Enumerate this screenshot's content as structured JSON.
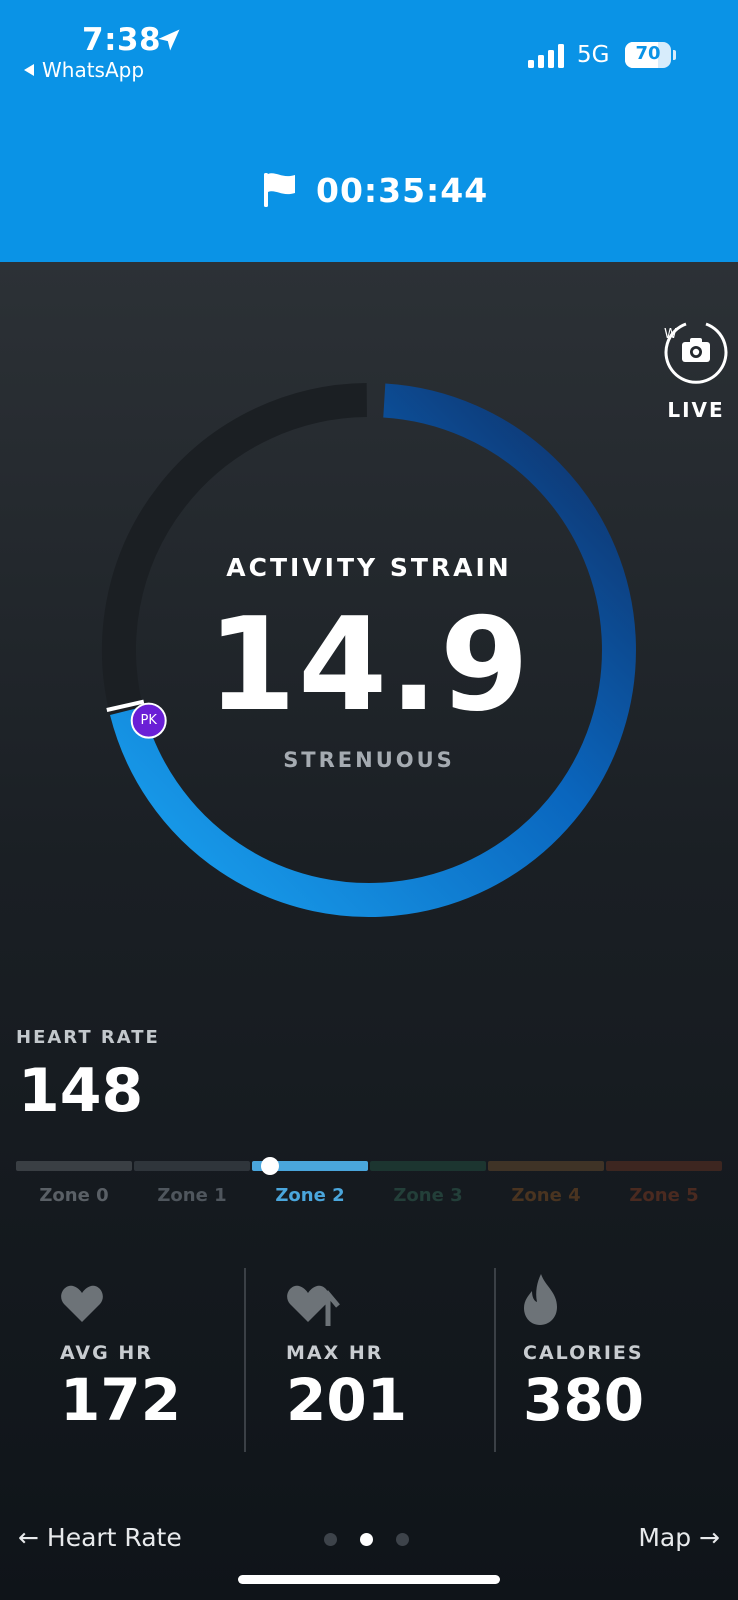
{
  "status_bar": {
    "time": "7:38",
    "back_app": "WhatsApp",
    "network": "5G",
    "battery": "70"
  },
  "header": {
    "timer": "00:35:44",
    "flag_icon": "flag-icon"
  },
  "live": {
    "label": "LIVE",
    "icon": "camera-icon"
  },
  "strain": {
    "title": "ACTIVITY STRAIN",
    "value": "14.9",
    "level": "STRENUOUS",
    "fraction_of_max": 0.709,
    "peak_marker": "PK",
    "colors": {
      "track": "#1b1f23",
      "arc_start": "#1a9ef0",
      "arc_end": "#0d3a7a",
      "marker": "#6a1fd6"
    }
  },
  "heart_rate": {
    "label": "HEART RATE",
    "value": "148",
    "active_zone_position": 0.36,
    "zones": [
      {
        "label": "Zone 0",
        "bar": "#3a3f44",
        "text": "#5a6066"
      },
      {
        "label": "Zone 1",
        "bar": "#2f353b",
        "text": "#4f565d"
      },
      {
        "label": "Zone 2",
        "bar": "#4aa6dc",
        "text": "#4aa6dc"
      },
      {
        "label": "Zone 3",
        "bar": "#1c3530",
        "text": "#233f39"
      },
      {
        "label": "Zone 4",
        "bar": "#3f3326",
        "text": "#4a3420"
      },
      {
        "label": "Zone 5",
        "bar": "#3d2620",
        "text": "#4a2a20"
      }
    ]
  },
  "stats": [
    {
      "icon": "heart-icon",
      "label": "AVG HR",
      "value": "172"
    },
    {
      "icon": "heart-up-icon",
      "label": "MAX HR",
      "value": "201"
    },
    {
      "icon": "flame-icon",
      "label": "CALORIES",
      "value": "380"
    }
  ],
  "footer": {
    "prev": "← Heart Rate",
    "next": "Map →",
    "page_index": 1,
    "page_count": 3
  }
}
